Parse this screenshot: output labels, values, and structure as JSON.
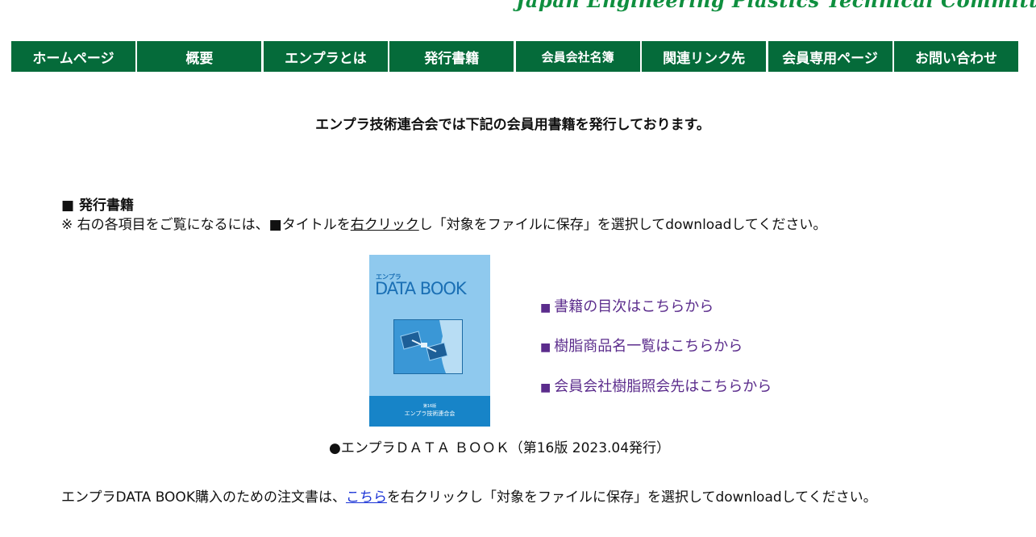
{
  "header": {
    "banner_text": "Japan Engineering Plastics Technical Committee"
  },
  "nav": {
    "items": [
      {
        "label": "ホームページ"
      },
      {
        "label": "概要"
      },
      {
        "label": "エンプラとは"
      },
      {
        "label": "発行書籍"
      },
      {
        "label": "会員会社名簿"
      },
      {
        "label": "関連リンク先"
      },
      {
        "label": "会員専用ページ"
      },
      {
        "label": "お問い合わせ"
      }
    ],
    "color": "#056b3a"
  },
  "main": {
    "lead": "エンプラ技術連合会では下記の会員用書籍を発行しております。",
    "section_heading": "■ 発行書籍",
    "note": {
      "prefix": "※ 右の各項目をご覧になるには、■タイトルを",
      "underline": "右クリック",
      "suffix": "し「対象をファイルに保存」を選択してdownloadしてください。"
    },
    "book": {
      "cover_small_title": "エンプラ",
      "cover_title": "DATA BOOK",
      "cover_edition": "第16版",
      "cover_publisher": "エンプラ技術連合会",
      "caption": "●エンプラＤＡＴＡ ＢＯＯＫ（第16版 2023.04発行）"
    },
    "links": [
      {
        "marker": "■",
        "label": "書籍の目次はこちらから"
      },
      {
        "marker": "■",
        "label": "樹脂商品名一覧はこちらから"
      },
      {
        "marker": "■",
        "label": "会員会社樹脂照会先はこちらから"
      }
    ],
    "order": {
      "prefix": "エンプラDATA BOOK購入のための注文書は、",
      "link_label": "こちら",
      "suffix": "を右クリックし「対象をファイルに保存」を選択してdownloadしてください。"
    }
  }
}
